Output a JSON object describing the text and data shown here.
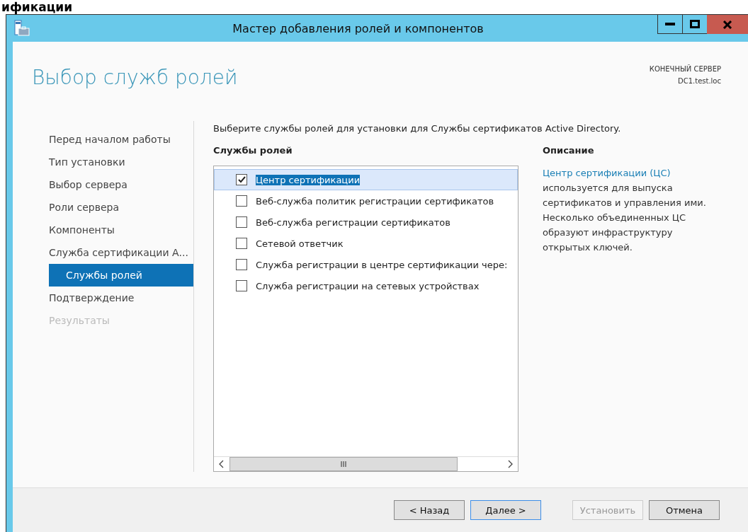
{
  "background_heading_fragment": "ификации",
  "window": {
    "title": "Мастер добавления ролей и компонентов"
  },
  "page_title": "Выбор служб ролей",
  "target_server": {
    "label": "КОНЕЧНЫЙ СЕРВЕР",
    "name": "DC1.test.loc"
  },
  "steps": [
    {
      "label": "Перед началом работы",
      "selected": false,
      "disabled": false
    },
    {
      "label": "Тип установки",
      "selected": false,
      "disabled": false
    },
    {
      "label": "Выбор сервера",
      "selected": false,
      "disabled": false
    },
    {
      "label": "Роли сервера",
      "selected": false,
      "disabled": false
    },
    {
      "label": "Компоненты",
      "selected": false,
      "disabled": false
    },
    {
      "label": "Служба сертификации А...",
      "selected": false,
      "disabled": false,
      "children": [
        {
          "label": "Службы ролей",
          "selected": true,
          "disabled": false
        }
      ]
    },
    {
      "label": "Подтверждение",
      "selected": false,
      "disabled": false
    },
    {
      "label": "Результаты",
      "selected": false,
      "disabled": true
    }
  ],
  "instruction": "Выберите службы ролей для установки для Службы сертификатов Active Directory.",
  "role_services": {
    "heading": "Службы ролей",
    "items": [
      {
        "label": "Центр сертификации",
        "checked": true,
        "selected": true
      },
      {
        "label": "Веб-служба политик регистрации сертификатов",
        "checked": false,
        "selected": false
      },
      {
        "label": "Веб-служба регистрации сертификатов",
        "checked": false,
        "selected": false
      },
      {
        "label": "Сетевой ответчик",
        "checked": false,
        "selected": false
      },
      {
        "label": "Служба регистрации в центре сертификации чере:",
        "checked": false,
        "selected": false
      },
      {
        "label": "Служба регистрации на сетевых устройствах",
        "checked": false,
        "selected": false
      }
    ]
  },
  "description": {
    "heading": "Описание",
    "link": "Центр сертификации (ЦС)",
    "text": "используется для выпуска сертификатов и управления ими. Несколько объединенных ЦС образуют инфраструктуру открытых ключей."
  },
  "buttons": [
    {
      "label": "< Назад",
      "default": false,
      "disabled": false
    },
    {
      "label": "Далее >",
      "default": true,
      "disabled": false
    },
    {
      "label": "Установить",
      "default": false,
      "disabled": true
    },
    {
      "label": "Отмена",
      "default": false,
      "disabled": false
    }
  ]
}
